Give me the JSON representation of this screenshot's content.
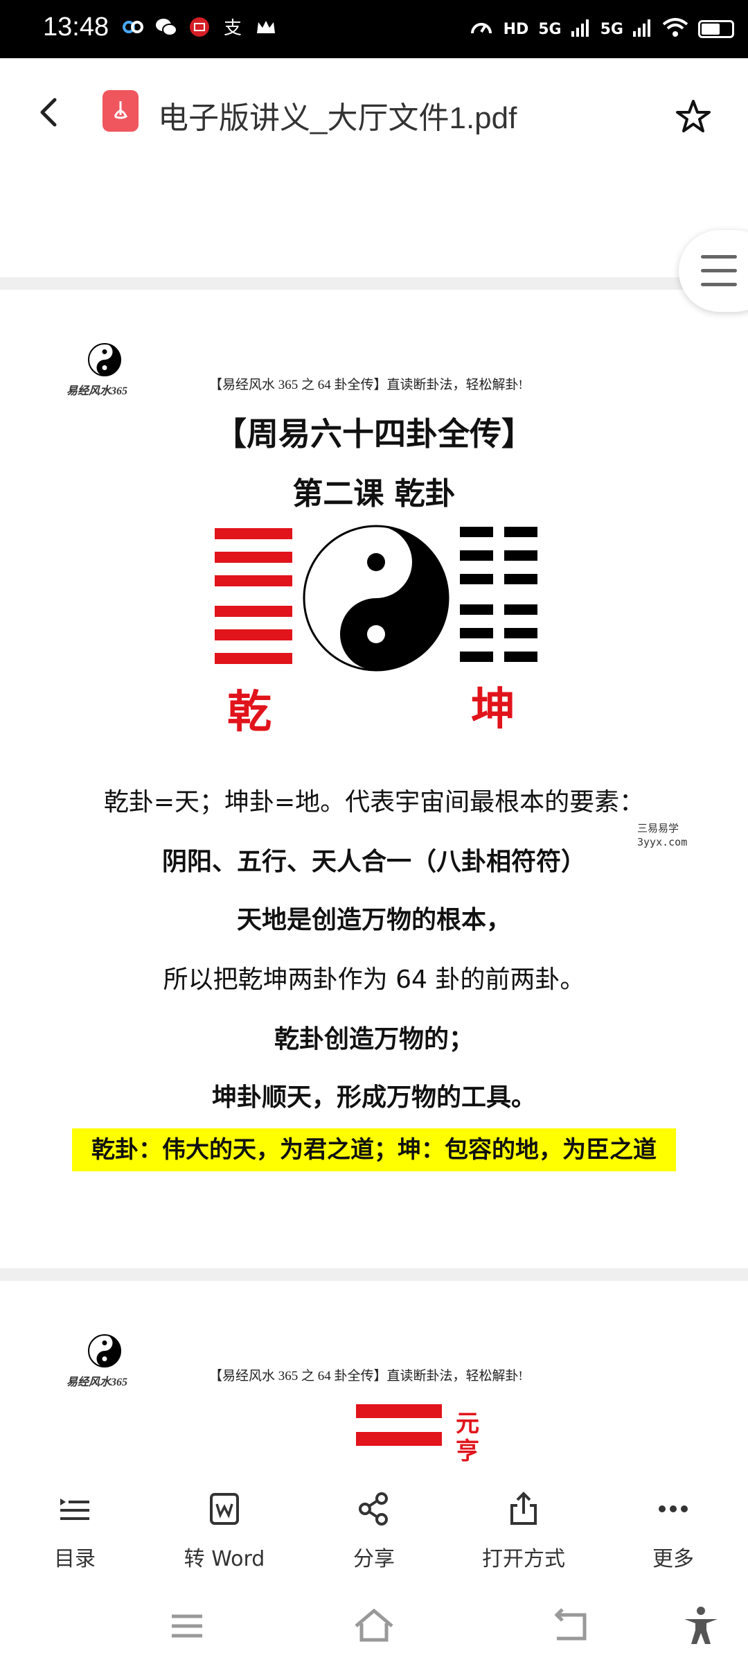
{
  "status_bar": {
    "time": "13:48",
    "left_icons": [
      "link-icon",
      "wechat-icon",
      "app-icon",
      "alipay-icon",
      "crown-icon"
    ],
    "right_icons": [
      "speed-icon",
      "hd-icon",
      "signal-5g-icon",
      "signal-5g-icon",
      "wifi-icon",
      "battery-icon"
    ],
    "net1": "5G",
    "net2": "5G",
    "hd": "HD"
  },
  "header": {
    "file_name": "电子版讲义_大厅文件1.pdf"
  },
  "page1": {
    "logo_text": "易经风水365",
    "tagline": "【易经风水 365 之 64 卦全传】直读断卦法，轻松解卦!",
    "title": "【周易六十四卦全传】",
    "subtitle": "第二课    乾卦",
    "left_char": "乾",
    "right_char": "坤",
    "lines": [
      "乾卦=天；坤卦=地。代表宇宙间最根本的要素：",
      "阴阳、五行、天人合一（八卦相符符）",
      "天地是创造万物的根本，",
      "所以把乾坤两卦作为 64 卦的前两卦。",
      "乾卦创造万物的；",
      "坤卦顺天，形成万物的工具。"
    ],
    "highlight": "乾卦：伟大的天，为君之道；坤：包容的地，为臣之道",
    "watermark_line1": "三易易学",
    "watermark_line2": "3yyx.com"
  },
  "page2": {
    "logo_text": "易经风水365",
    "tagline": "【易经风水 365 之 64 卦全传】直读断卦法，轻松解卦!",
    "chars": "元\n亨"
  },
  "toolbar": {
    "items": [
      {
        "label": "目录",
        "icon": "toc-icon"
      },
      {
        "label": "转 Word",
        "icon": "word-icon"
      },
      {
        "label": "分享",
        "icon": "share-icon"
      },
      {
        "label": "打开方式",
        "icon": "open-with-icon"
      },
      {
        "label": "更多",
        "icon": "more-icon"
      }
    ]
  },
  "colors": {
    "accent_red": "#e1131b",
    "highlight": "#ffff00",
    "pdf_icon": "#f0565e"
  }
}
